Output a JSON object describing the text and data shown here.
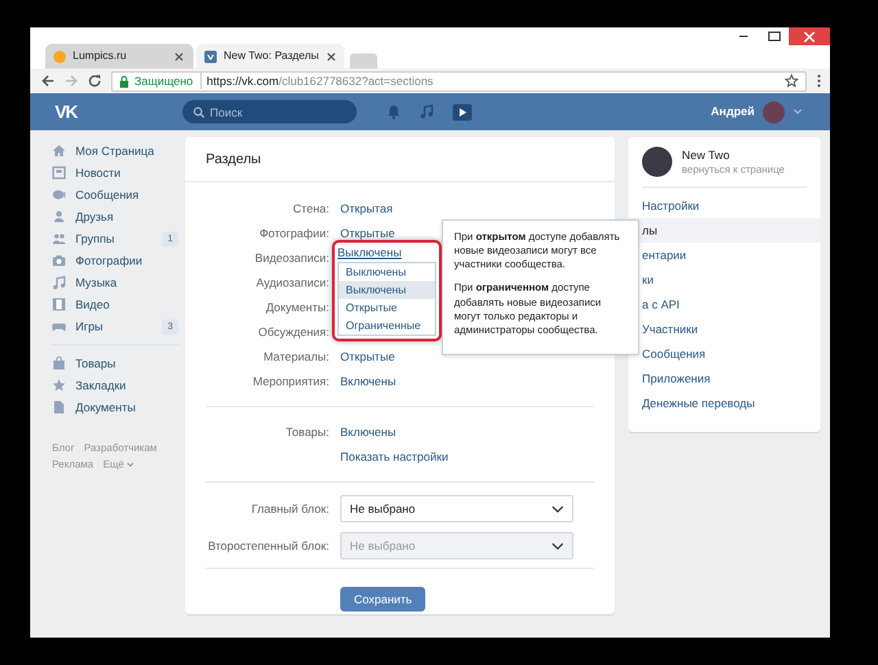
{
  "browser": {
    "tabs": [
      {
        "title": "Lumpics.ru",
        "selected": false
      },
      {
        "title": "New Two: Разделы",
        "selected": true
      }
    ],
    "security_label": "Защищено",
    "url_host": "https://vk.com",
    "url_path": "/club162778632?act=sections"
  },
  "header": {
    "logo": "VK",
    "search_placeholder": "Поиск",
    "user_name": "Андрей"
  },
  "left_menu": {
    "groups": [
      [
        {
          "label": "Моя Страница"
        },
        {
          "label": "Новости"
        },
        {
          "label": "Сообщения"
        },
        {
          "label": "Друзья"
        },
        {
          "label": "Группы",
          "count": "1"
        },
        {
          "label": "Фотографии"
        },
        {
          "label": "Музыка"
        },
        {
          "label": "Видео"
        },
        {
          "label": "Игры",
          "count": "3"
        }
      ],
      [
        {
          "label": "Товары"
        },
        {
          "label": "Закладки"
        },
        {
          "label": "Документы"
        }
      ]
    ],
    "footer_links": [
      "Блог",
      "Разработчикам",
      "Реклама",
      "Ещё"
    ]
  },
  "main": {
    "title": "Разделы",
    "settings": [
      {
        "label": "Стена:",
        "value": "Открытая"
      },
      {
        "label": "Фотографии:",
        "value": "Открытые"
      },
      {
        "label": "Видеозаписи:"
      },
      {
        "label": "Аудиозаписи:"
      },
      {
        "label": "Документы:"
      },
      {
        "label": "Обсуждения:"
      },
      {
        "label": "Материалы:",
        "value": "Открытые"
      },
      {
        "label": "Мероприятия:",
        "value": "Включены"
      }
    ],
    "goods": {
      "label": "Товары:",
      "value": "Включены",
      "link": "Показать настройки"
    },
    "blocks": [
      {
        "label": "Главный блок:",
        "value": "Не выбрано",
        "disabled": false
      },
      {
        "label": "Второстепенный блок:",
        "value": "Не выбрано",
        "disabled": true
      }
    ],
    "save_button": "Сохранить",
    "dropdown": {
      "current": "Выключены",
      "options": [
        {
          "label": "Выключены",
          "highlighted": false
        },
        {
          "label": "Выключены",
          "highlighted": true
        },
        {
          "label": "Открытые",
          "highlighted": false
        },
        {
          "label": "Ограниченные",
          "highlighted": false
        }
      ]
    }
  },
  "tooltip": {
    "paragraphs": [
      "При **открытом** доступе добавлять новые видеозаписи могут все участники сообщества.",
      "При **ограниченном** доступе добавлять новые видеозаписи могут только редакторы и администраторы сообщества."
    ]
  },
  "right_menu": {
    "group_name": "New Two",
    "back_link": "вернуться к странице",
    "items": [
      {
        "label": "Настройки",
        "selected": false
      },
      {
        "label": "лы",
        "selected": true
      },
      {
        "label": "ентарии",
        "selected": false
      },
      {
        "label": "ки",
        "selected": false
      },
      {
        "label": "а с API",
        "selected": false
      },
      {
        "label": "Участники",
        "selected": false
      },
      {
        "label": "Сообщения",
        "selected": false
      },
      {
        "label": "Приложения",
        "selected": false
      },
      {
        "label": "Денежные переводы",
        "selected": false
      }
    ]
  }
}
